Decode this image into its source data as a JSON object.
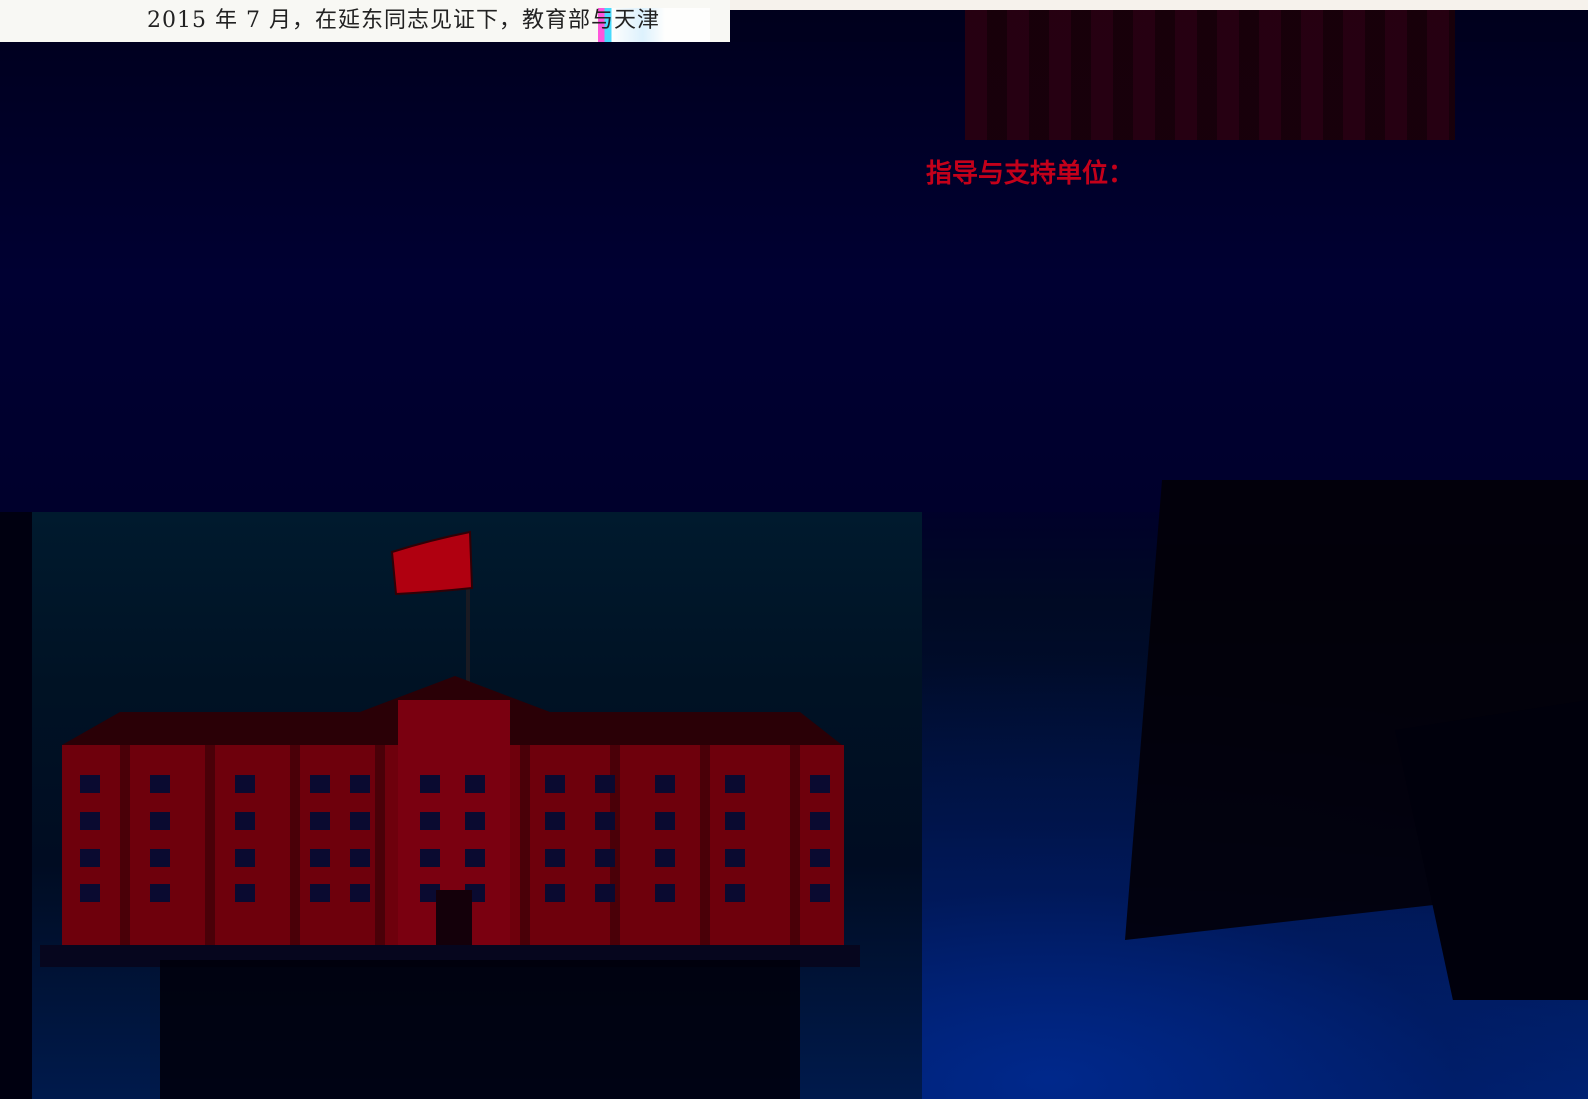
{
  "document": {
    "top_line": "2015 年 7 月，在延东同志见证下，教育部与天津"
  },
  "poster": {
    "section_title": "指导与支持单位："
  },
  "colors": {
    "background_dark": "#000020",
    "background_blue": "#00226e",
    "building_red": "#7a0010",
    "flag_red": "#b00010",
    "title_red": "#c4001a"
  },
  "images": {
    "building": "red-school-building-with-flag",
    "flag": "red-flag"
  }
}
